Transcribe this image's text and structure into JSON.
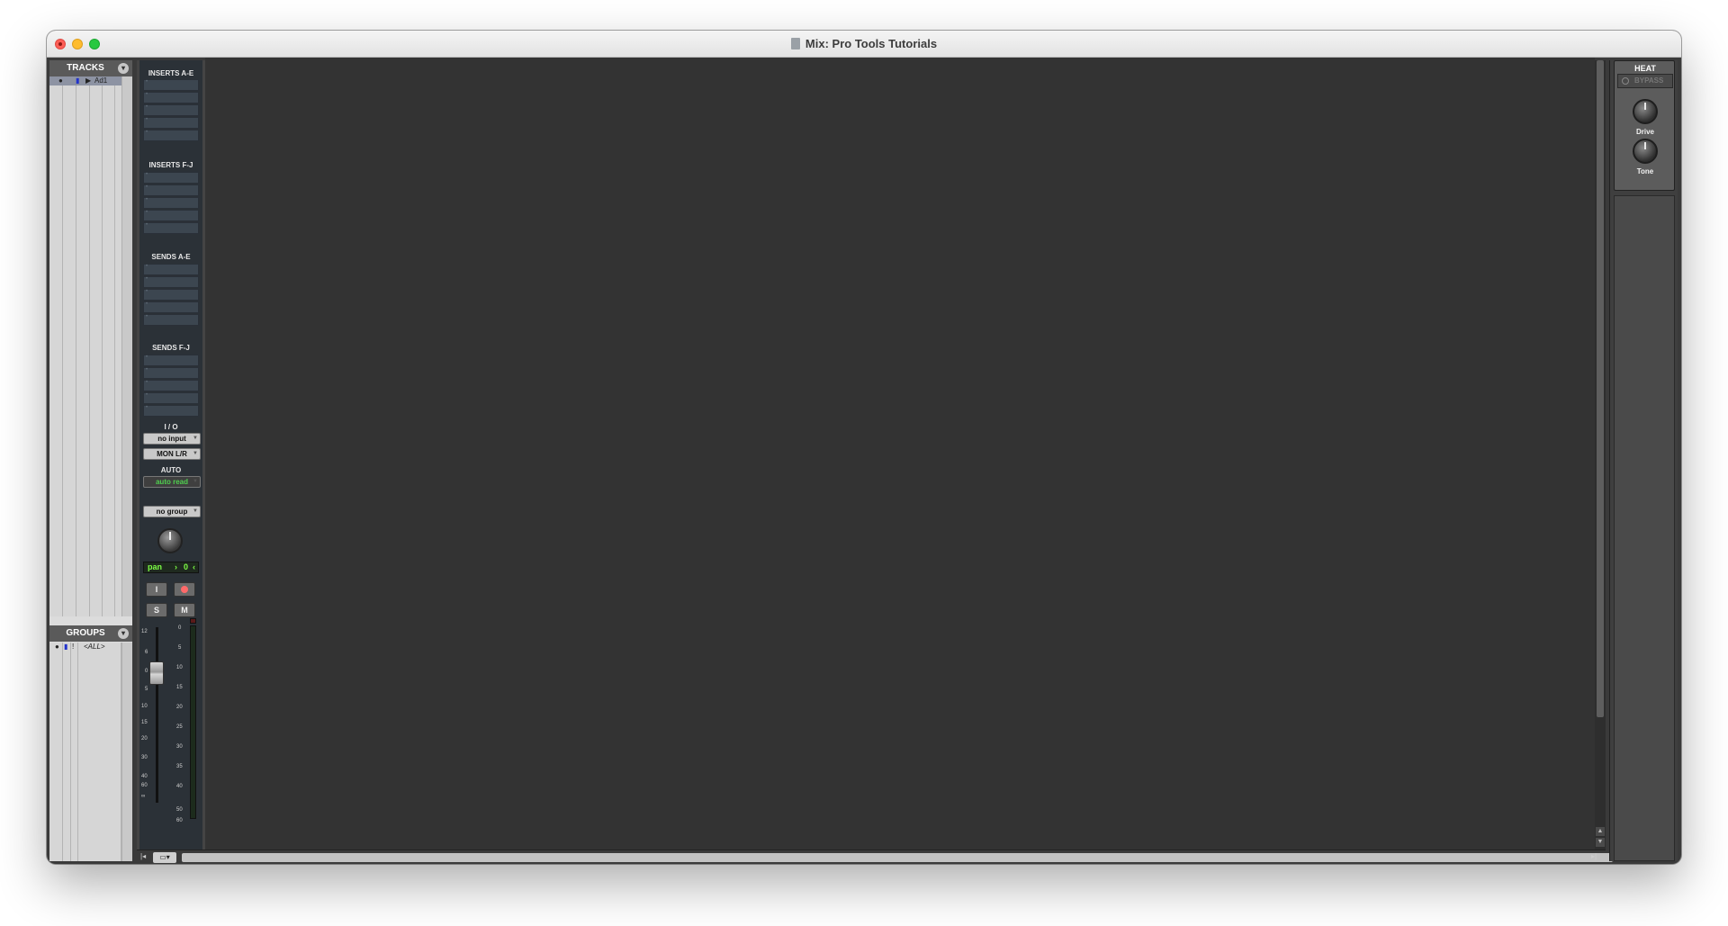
{
  "window": {
    "title": "Mix: Pro Tools Tutorials"
  },
  "tracks_panel": {
    "header": "TRACKS",
    "tracks": [
      {
        "name": "Ad1"
      }
    ]
  },
  "groups_panel": {
    "header": "GROUPS",
    "groups": [
      {
        "flag": "!",
        "name": "<ALL>"
      }
    ]
  },
  "channel_strip": {
    "inserts_ae_label": "INSERTS A-E",
    "inserts_fj_label": "INSERTS F-J",
    "sends_ae_label": "SENDS A-E",
    "sends_fj_label": "SENDS F-J",
    "io_label": "I / O",
    "input": "no input",
    "output": "MON L/R",
    "auto_label": "AUTO",
    "auto_mode": "auto read",
    "group": "no group",
    "pan_label": "pan",
    "pan_value": "0",
    "solo_label": "S",
    "mute_label": "M",
    "fader_scale": [
      "12",
      "6",
      "0",
      "5",
      "10",
      "15",
      "20",
      "30",
      "40",
      "60",
      "∞"
    ],
    "meter_scale": [
      "0",
      "5",
      "10",
      "15",
      "20",
      "25",
      "30",
      "35",
      "40",
      "50",
      "60"
    ]
  },
  "plugin": {
    "title": "HEAT",
    "bypass_label": "BYPASS",
    "knobs": [
      {
        "label": "Drive"
      },
      {
        "label": "Tone"
      }
    ]
  },
  "icons": {
    "close": "close-icon",
    "menu": "panel-menu-icon",
    "power": "power-icon",
    "record": "record-icon",
    "input": "input-monitor-icon"
  },
  "colors": {
    "main_bg": "#333333",
    "strip_bg": "#2b3137",
    "pan_text": "#7dff45",
    "auto_read": "#4fcf4f"
  }
}
